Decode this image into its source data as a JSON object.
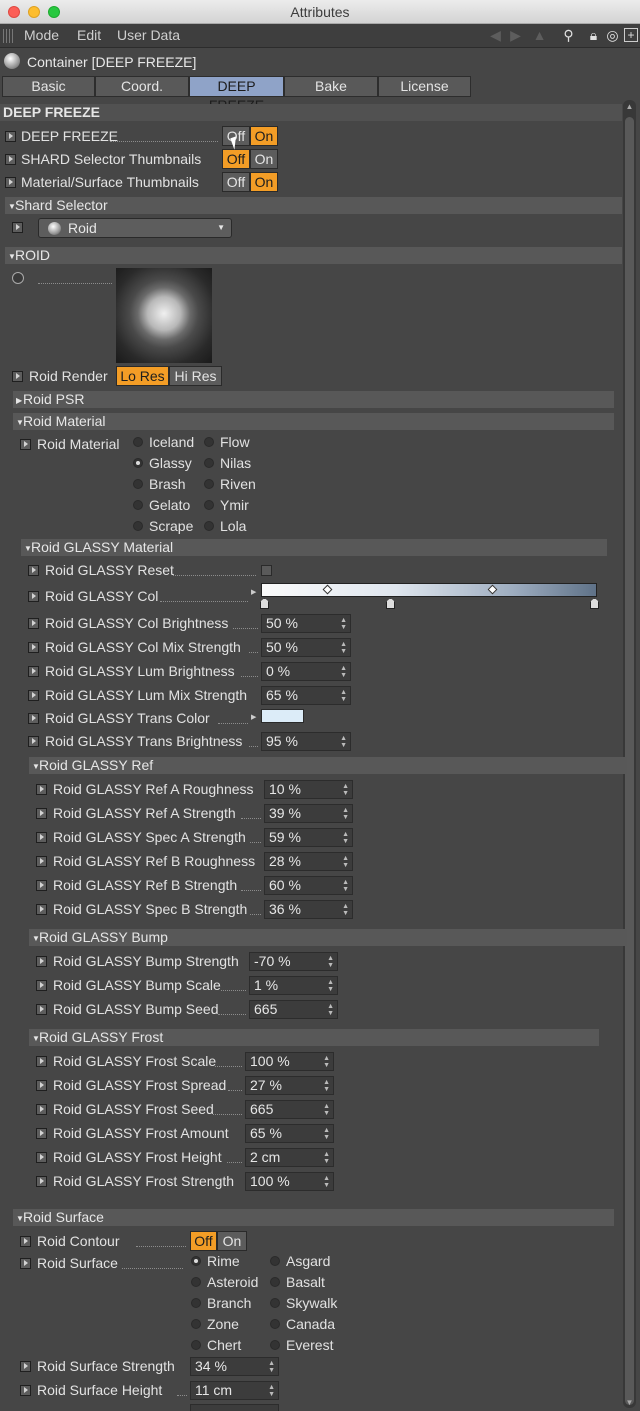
{
  "window": {
    "title": "Attributes"
  },
  "menu": {
    "mode": "Mode",
    "edit": "Edit",
    "user_data": "User Data"
  },
  "object": {
    "title": "Container [DEEP FREEZE]"
  },
  "tabs": [
    {
      "label": "Basic"
    },
    {
      "label": "Coord."
    },
    {
      "label": "DEEP FREEZE"
    },
    {
      "label": "Bake"
    },
    {
      "label": "License"
    }
  ],
  "toggle": {
    "off": "Off",
    "on": "On"
  },
  "deep_freeze": {
    "header": "DEEP FREEZE",
    "rows": [
      {
        "label": "DEEP FREEZE",
        "value": "On"
      },
      {
        "label": "SHARD Selector Thumbnails",
        "value": "Off"
      },
      {
        "label": "Material/Surface Thumbnails",
        "value": "On"
      }
    ]
  },
  "shard_selector": {
    "header": "Shard Selector",
    "value": "Roid"
  },
  "roid": {
    "header": "ROID",
    "render_label": "Roid Render",
    "render_lo": "Lo Res",
    "render_hi": "Hi Res",
    "render_value": "Lo Res",
    "psr": "Roid PSR",
    "material_header": "Roid Material",
    "material_label": "Roid Material",
    "materials": [
      [
        "Iceland",
        "Flow"
      ],
      [
        "Glassy",
        "Nilas"
      ],
      [
        "Brash",
        "Riven"
      ],
      [
        "Gelato",
        "Ymir"
      ],
      [
        "Scrape",
        "Lola"
      ]
    ],
    "material_selected": "Glassy"
  },
  "glassy": {
    "header": "Roid GLASSY Material",
    "reset": "Roid GLASSY Reset",
    "col": "Roid GLASSY Col",
    "trans_color": "Roid GLASSY Trans Color",
    "trans_color_hex": "#dcecf8",
    "rows": [
      {
        "label": "Roid GLASSY Col Brightness",
        "value": "50 %"
      },
      {
        "label": "Roid GLASSY Col Mix Strength",
        "value": "50 %"
      },
      {
        "label": "Roid GLASSY Lum Brightness",
        "value": "0 %"
      },
      {
        "label": "Roid GLASSY Lum Mix Strength",
        "value": "65 %"
      }
    ],
    "trans_brightness": {
      "label": "Roid GLASSY Trans Brightness",
      "value": "95 %"
    }
  },
  "ref": {
    "header": "Roid GLASSY Ref",
    "rows": [
      {
        "label": "Roid GLASSY Ref A Roughness",
        "value": "10 %"
      },
      {
        "label": "Roid GLASSY Ref A Strength",
        "value": "39 %"
      },
      {
        "label": "Roid GLASSY Spec A Strength",
        "value": "59 %"
      },
      {
        "label": "Roid GLASSY Ref B Roughness",
        "value": "28 %"
      },
      {
        "label": "Roid GLASSY Ref B Strength",
        "value": "60 %"
      },
      {
        "label": "Roid GLASSY Spec B Strength",
        "value": "36 %"
      }
    ]
  },
  "bump": {
    "header": "Roid GLASSY Bump",
    "rows": [
      {
        "label": "Roid GLASSY Bump Strength",
        "value": "-70 %"
      },
      {
        "label": "Roid GLASSY Bump Scale",
        "value": "1 %"
      },
      {
        "label": "Roid GLASSY Bump Seed",
        "value": "665"
      }
    ]
  },
  "frost": {
    "header": "Roid GLASSY Frost",
    "rows": [
      {
        "label": "Roid GLASSY Frost Scale",
        "value": "100 %"
      },
      {
        "label": "Roid GLASSY Frost Spread",
        "value": "27 %"
      },
      {
        "label": "Roid GLASSY Frost Seed",
        "value": "665"
      },
      {
        "label": "Roid GLASSY Frost Amount",
        "value": "65 %"
      },
      {
        "label": "Roid GLASSY Frost Height",
        "value": "2 cm"
      },
      {
        "label": "Roid GLASSY Frost Strength",
        "value": "100 %"
      }
    ]
  },
  "surface": {
    "header": "Roid Surface",
    "contour_label": "Roid Contour",
    "contour_value": "Off",
    "surface_label": "Roid Surface",
    "options": [
      [
        "Rime",
        "Asgard"
      ],
      [
        "Asteroid",
        "Basalt"
      ],
      [
        "Branch",
        "Skywalk"
      ],
      [
        "Zone",
        "Canada"
      ],
      [
        "Chert",
        "Everest"
      ]
    ],
    "selected": "Rime",
    "strength": {
      "label": "Roid Surface Strength",
      "value": "34 %"
    },
    "height": {
      "label": "Roid Surface Height",
      "value": "11 cm"
    }
  },
  "colors": {
    "accent": "#f39d26",
    "tab_active": "#8fa3c8",
    "panel": "#464646"
  }
}
